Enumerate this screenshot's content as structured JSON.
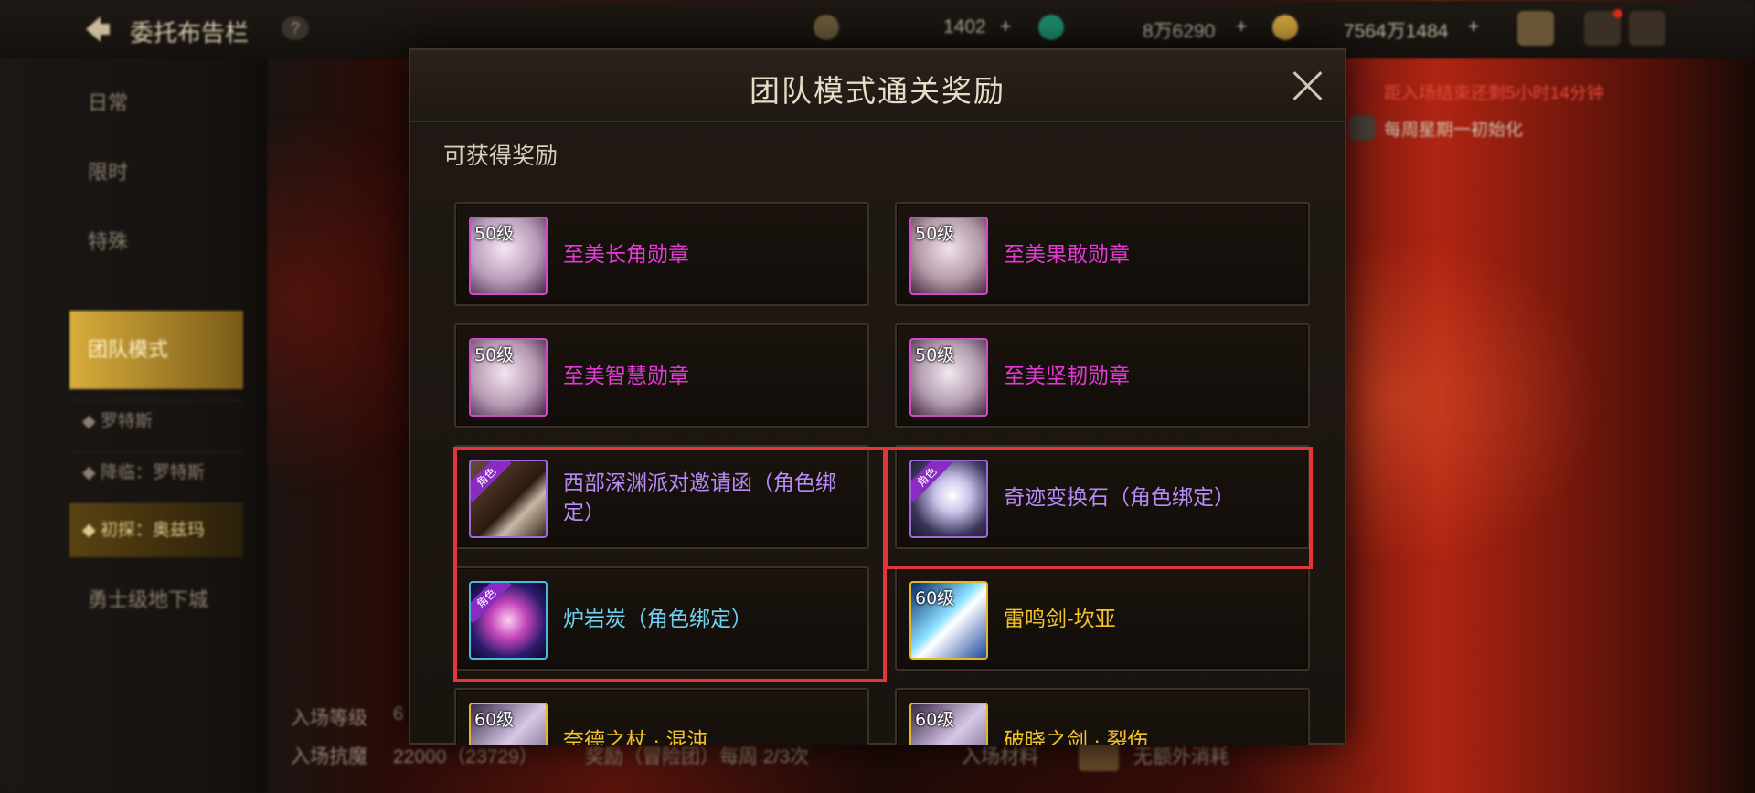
{
  "header": {
    "title": "委托布告栏",
    "help": "?",
    "currencies": [
      {
        "icon": "moon-token-icon",
        "value": "1402"
      },
      {
        "icon": "green-crystal-icon",
        "value": "8万6290"
      },
      {
        "icon": "gold-coin-icon",
        "value": "7564万1484"
      }
    ],
    "add": "+"
  },
  "sidebar": {
    "items": [
      {
        "label": "日常"
      },
      {
        "label": "限时"
      },
      {
        "label": "特殊"
      },
      {
        "label": "团队模式"
      }
    ],
    "subitems": [
      {
        "label": "◆ 罗特斯"
      },
      {
        "label": "◆ 降临：罗特斯"
      },
      {
        "label": "◆ 初探：奥兹玛"
      }
    ],
    "extra": "勇士级地下城"
  },
  "right_info": {
    "line1": "距入场结束还剩5小时14分钟",
    "line2": "每周星期一初始化"
  },
  "bottom_info": {
    "level_label": "入场等级",
    "level_value": "6",
    "resist_label": "入场抗魔",
    "resist_value": "22000（23729）",
    "reward_info": "奖励（冒险团）每周 2/3次",
    "material_label": "入场材料",
    "material_value": "无额外消耗"
  },
  "modal": {
    "title": "团队模式通关奖励",
    "section_label": "可获得奖励",
    "rewards": [
      {
        "level": "50级",
        "name": "至美长角勋章",
        "grade": "pink",
        "icon": "horn-medal-icon"
      },
      {
        "level": "50级",
        "name": "至美果敢勋章",
        "grade": "pink",
        "icon": "helmet-medal-icon"
      },
      {
        "level": "50级",
        "name": "至美智慧勋章",
        "grade": "pink",
        "icon": "owl-medal-icon"
      },
      {
        "level": "50级",
        "name": "至美坚韧勋章",
        "grade": "pink",
        "icon": "shield-medal-icon"
      },
      {
        "bind": "角色",
        "name": "西部深渊派对邀请函（角色绑定）",
        "grade": "purple",
        "icon": "invitation-box-icon"
      },
      {
        "bind": "角色",
        "name": "奇迹变换石（角色绑定）",
        "grade": "purple",
        "icon": "crystal-stone-icon"
      },
      {
        "bind": "角色",
        "name": "炉岩炭（角色绑定）",
        "grade": "blue",
        "icon": "lava-orb-icon"
      },
      {
        "level": "60级",
        "name": "雷鸣剑-坎亚",
        "grade": "gold",
        "icon": "thunder-sword-icon"
      },
      {
        "level": "60级",
        "name": "奈德之杖 · 混沌",
        "grade": "gold",
        "icon": "weapon-icon"
      },
      {
        "level": "60级",
        "name": "破晓之剑 · 裂伤",
        "grade": "gold",
        "icon": "weapon-icon"
      }
    ]
  },
  "colors": {
    "pink": "#e33ad6",
    "purple": "#b88af6",
    "blue": "#6fd0ee",
    "gold": "#f3c22a",
    "highlight": "#e2363a"
  }
}
